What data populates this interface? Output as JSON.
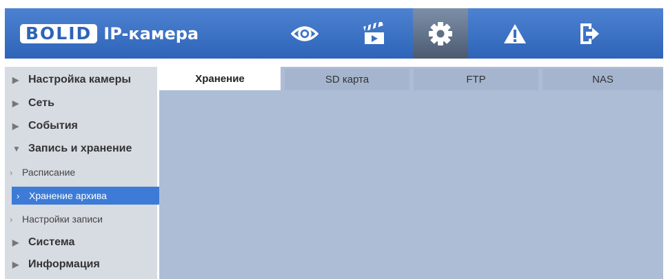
{
  "header": {
    "logo_text": "BOLID",
    "title": "IP-камера",
    "nav": [
      {
        "icon": "eye-icon",
        "active": false
      },
      {
        "icon": "clapperboard-icon",
        "active": false
      },
      {
        "icon": "gear-icon",
        "active": true
      },
      {
        "icon": "warning-icon",
        "active": false
      },
      {
        "icon": "logout-icon",
        "active": false
      }
    ],
    "colors": {
      "bar": "#3a6fc2",
      "active": "#5f6f86"
    }
  },
  "sidebar": {
    "items": [
      {
        "label": "Настройка камеры",
        "expanded": false
      },
      {
        "label": "Сеть",
        "expanded": false
      },
      {
        "label": "События",
        "expanded": false
      },
      {
        "label": "Запись и хранение",
        "expanded": true
      },
      {
        "label": "Система",
        "expanded": false
      },
      {
        "label": "Информация",
        "expanded": false
      }
    ],
    "subitems": [
      {
        "label": "Расписание",
        "selected": false
      },
      {
        "label": "Хранение архива",
        "selected": true
      },
      {
        "label": "Настройки записи",
        "selected": false
      }
    ],
    "arrow_collapsed": "▶",
    "arrow_expanded": "▼",
    "chevron": "›"
  },
  "tabs": [
    {
      "label": "Хранение",
      "active": true
    },
    {
      "label": "SD карта",
      "active": false
    },
    {
      "label": "FTP",
      "active": false
    },
    {
      "label": "NAS",
      "active": false
    }
  ]
}
